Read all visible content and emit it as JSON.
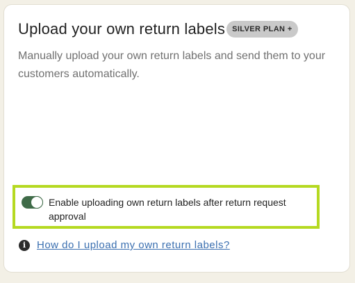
{
  "card": {
    "title": "Upload your own return labels",
    "badge": "SILVER PLAN +",
    "description": "Manually upload your own return labels and send them to your customers automatically."
  },
  "toggle": {
    "enabled": true,
    "label": "Enable uploading own return labels after return request approval"
  },
  "help": {
    "icon": "info-icon",
    "link_text": "How do I upload my own return labels?"
  },
  "colors": {
    "toggle_on": "#3f6b48",
    "highlight_border": "#b5d921",
    "link": "#3a6fb0",
    "badge_bg": "#c9c9c9"
  }
}
